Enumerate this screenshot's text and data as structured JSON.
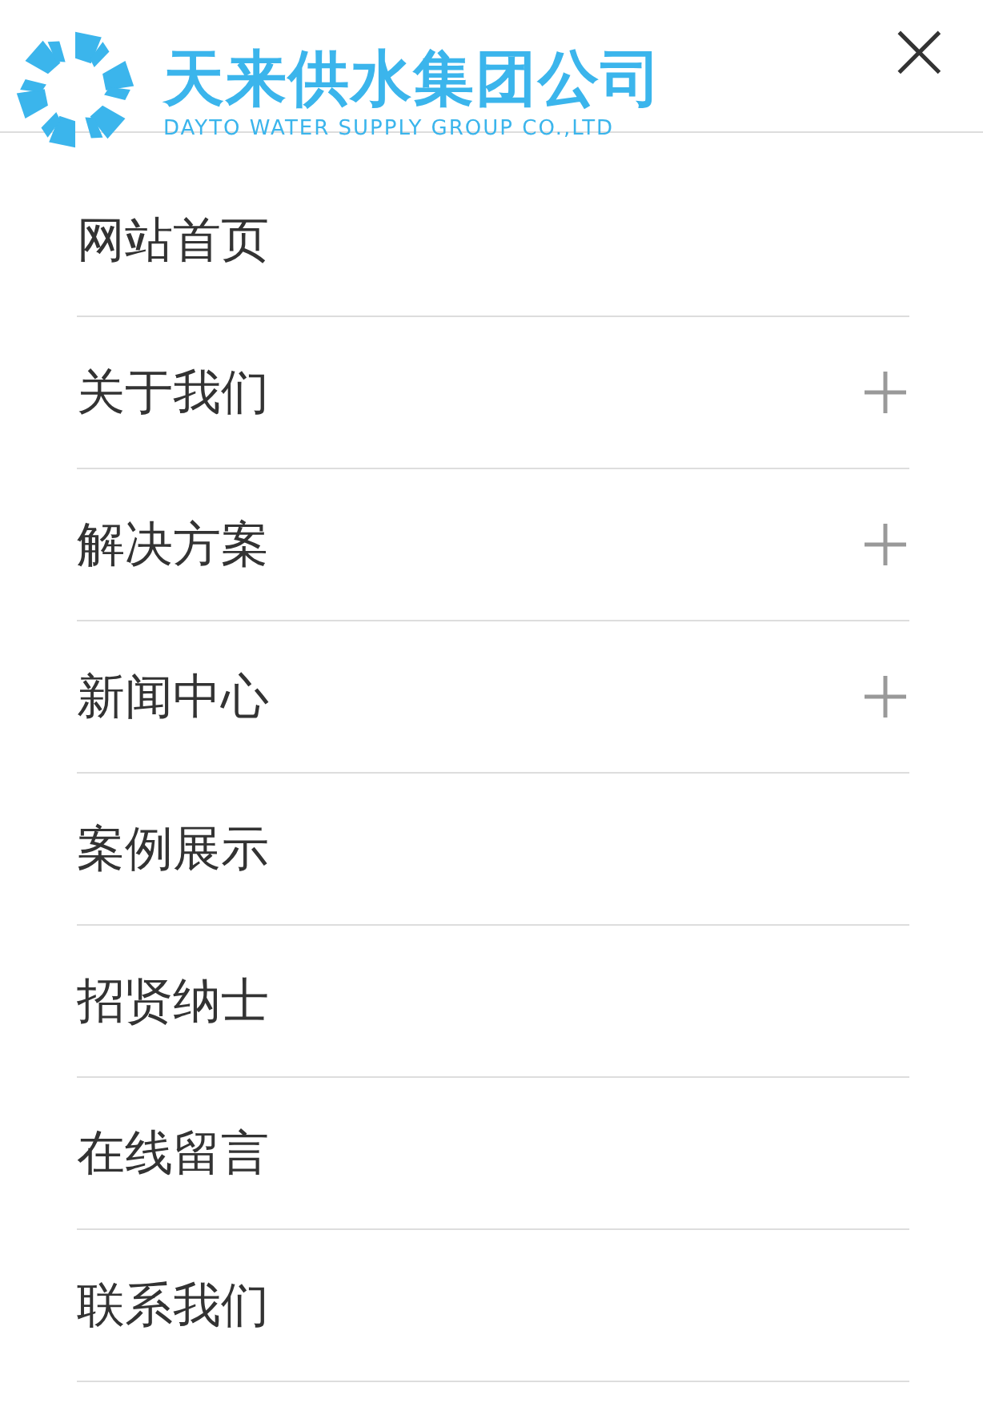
{
  "header": {
    "logo_title": "天来供水集团公司",
    "logo_subtitle": "DAYTO WATER SUPPLY GROUP CO.,LTD",
    "close": "×"
  },
  "menu": [
    {
      "label": "网站首页",
      "expandable": false
    },
    {
      "label": "关于我们",
      "expandable": true
    },
    {
      "label": "解决方案",
      "expandable": true
    },
    {
      "label": "新闻中心",
      "expandable": true
    },
    {
      "label": "案例展示",
      "expandable": false
    },
    {
      "label": "招贤纳士",
      "expandable": false
    },
    {
      "label": "在线留言",
      "expandable": false
    },
    {
      "label": "联系我们",
      "expandable": false
    }
  ]
}
